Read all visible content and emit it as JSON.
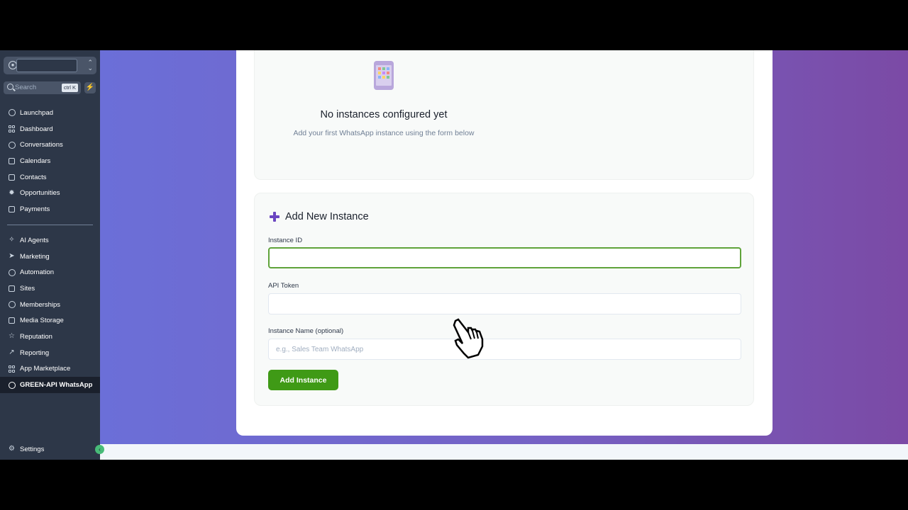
{
  "sidebar": {
    "account_icon": "user-icon",
    "account_chevron": "⌃⌄",
    "search": {
      "label": "Search",
      "shortcut": "ctrl K"
    },
    "bolt": "⚡",
    "nav_primary": [
      {
        "label": "Launchpad",
        "icon": "rocket-icon"
      },
      {
        "label": "Dashboard",
        "icon": "grid-icon"
      },
      {
        "label": "Conversations",
        "icon": "chat-icon"
      },
      {
        "label": "Calendars",
        "icon": "calendar-icon"
      },
      {
        "label": "Contacts",
        "icon": "contacts-icon"
      },
      {
        "label": "Opportunities",
        "icon": "opportunities-icon"
      },
      {
        "label": "Payments",
        "icon": "payments-icon"
      }
    ],
    "nav_secondary": [
      {
        "label": "AI Agents",
        "icon": "sparkle-icon"
      },
      {
        "label": "Marketing",
        "icon": "send-icon"
      },
      {
        "label": "Automation",
        "icon": "automation-icon"
      },
      {
        "label": "Sites",
        "icon": "sites-icon"
      },
      {
        "label": "Memberships",
        "icon": "badge-icon"
      },
      {
        "label": "Media Storage",
        "icon": "image-icon"
      },
      {
        "label": "Reputation",
        "icon": "star-icon"
      },
      {
        "label": "Reporting",
        "icon": "trend-icon"
      },
      {
        "label": "App Marketplace",
        "icon": "apps-icon"
      },
      {
        "label": "GREEN-API WhatsApp",
        "icon": "whatsapp-icon",
        "active": true
      }
    ],
    "settings": {
      "label": "Settings",
      "icon": "gear-icon"
    },
    "collapse": "‹"
  },
  "main": {
    "empty_state": {
      "title": "No instances configured yet",
      "subtitle": "Add your first WhatsApp instance using the form below"
    },
    "form": {
      "title": "Add New Instance",
      "instance_id": {
        "label": "Instance ID",
        "value": "",
        "placeholder": ""
      },
      "api_token": {
        "label": "API Token",
        "value": "",
        "placeholder": ""
      },
      "instance_name": {
        "label": "Instance Name (optional)",
        "value": "",
        "placeholder": "e.g., Sales Team WhatsApp"
      },
      "submit_label": "Add Instance"
    }
  },
  "colors": {
    "sidebar_bg": "#2d3748",
    "accent_green": "#3f9a16",
    "accent_purple": "#6b46c1",
    "gradient_start": "#6b6fd8",
    "gradient_end": "#7b4aa5"
  }
}
